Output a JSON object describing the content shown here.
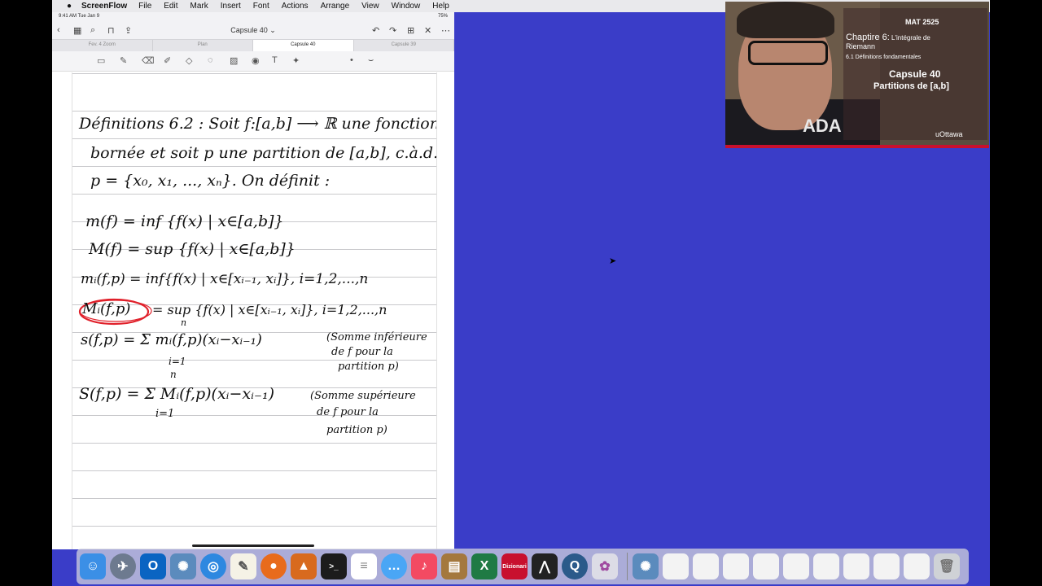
{
  "menubar": {
    "app_name": "ScreenFlow",
    "items": [
      "File",
      "Edit",
      "Mark",
      "Insert",
      "Font",
      "Actions",
      "Arrange",
      "View",
      "Window",
      "Help"
    ]
  },
  "ipad": {
    "status_time": "9:41 AM   Tue Jan 9",
    "status_battery": "75%",
    "document_title": "Capsule 40 ⌄",
    "tabs": [
      "Fev. 4 Zoom",
      "Plan",
      "Capsule 40",
      "Capsule 39"
    ],
    "active_tab": 2
  },
  "notes": {
    "line1": "Définitions 6.2 :  Soit f:[a,b] ⟶ ℝ une fonction",
    "line2": "bornée et soit p une partition de [a,b], c.à.d.",
    "line3": "p = {x₀, x₁, ..., xₙ}.  On définit :",
    "m_f": "m(f) = inf {f(x) | x∈[a,b]}",
    "M_f": "M(f) = sup {f(x) | x∈[a,b]}",
    "m_i": "mᵢ(f,p) = inf{f(x) | x∈[xᵢ₋₁, xᵢ]},  i=1,2,...,n",
    "M_i_label": "Mᵢ(f,p)",
    "M_i_rest": "= sup {f(x) | x∈[xᵢ₋₁, xᵢ]},  i=1,2,...,n",
    "s_eq": "s(f,p) =  Σ  mᵢ(f,p)(xᵢ−xᵢ₋₁)",
    "s_idx_top": "n",
    "s_idx_bot": "i=1",
    "s_note1": "(Somme inférieure",
    "s_note2": "de f pour la",
    "s_note3": "partition p)",
    "S_eq": "S(f,p) =  Σ Mᵢ(f,p)(xᵢ−xᵢ₋₁)",
    "S_idx_top": "n",
    "S_idx_bot": "i=1",
    "S_note1": "(Somme supérieure",
    "S_note2": "de f pour la",
    "S_note3": "partition p)"
  },
  "video_overlay": {
    "course": "MAT 2525",
    "chapter_big": "Chaptire 6:",
    "chapter_small": " L'intégrale de",
    "chapter_line2": "Riemann",
    "section": "6.1 Définitions fondamentales",
    "capsule": "Capsule 40",
    "topic": "Partitions de [a,b]",
    "university": "uOttawa",
    "shirt_text": "ADA"
  },
  "dock": {
    "icons": [
      "finder-icon",
      "launchpad-icon",
      "outlook-icon",
      "maple-icon",
      "safari-icon",
      "textedit-icon",
      "firefox-icon",
      "matlab-icon",
      "terminal-icon",
      "notes-icon",
      "messages-icon",
      "music-icon",
      "archive-icon",
      "excel-icon",
      "dizionari-icon",
      "acrobat-icon",
      "quicktime-icon",
      "gamecenter-icon"
    ],
    "dizionari_label": "Dizionari",
    "excel_label": "X"
  }
}
